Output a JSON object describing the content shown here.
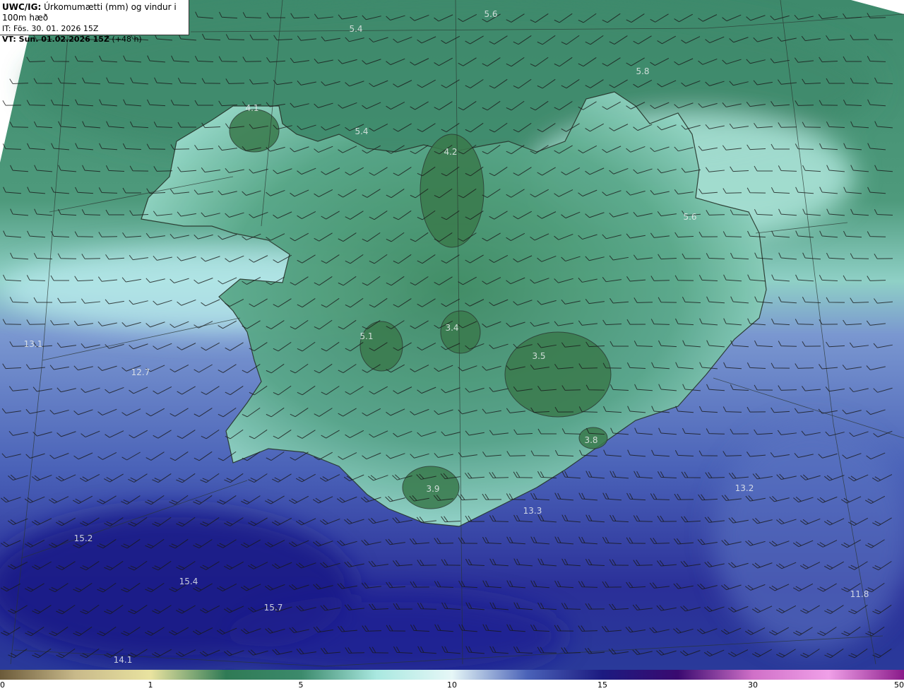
{
  "header": {
    "model_code": "UWC/IG:",
    "title": "Úrkomumætti (mm) og vindur i 100m hæð",
    "init_time": "IT: Fös. 30. 01. 2026 15Z",
    "valid_label": "VT: Sun. 01.02.2026 15Z",
    "lead_time": "(+48 h)"
  },
  "colorbar": {
    "ticks": [
      "0",
      "1",
      "5",
      "10",
      "15",
      "30",
      "50"
    ],
    "colors": [
      "#6b5a3a",
      "#c8b98a",
      "#e9e3a0",
      "#2f7a55",
      "#3c8a6c",
      "#a9e8e0",
      "#e6f7f7",
      "#4a62b8",
      "#1c1a80",
      "#3a0a70",
      "#d070c8",
      "#f0a0e8",
      "#8a1a8a"
    ]
  },
  "map_values": [
    {
      "text": "5.6"
    },
    {
      "text": "5.4"
    },
    {
      "text": "5.8"
    },
    {
      "text": "4.1"
    },
    {
      "text": "5.4"
    },
    {
      "text": "4.2"
    },
    {
      "text": "5.6"
    },
    {
      "text": "3.4"
    },
    {
      "text": "5.1"
    },
    {
      "text": "3.5"
    },
    {
      "text": "13.1"
    },
    {
      "text": "12.7"
    },
    {
      "text": "3.8"
    },
    {
      "text": "3.9"
    },
    {
      "text": "13.2"
    },
    {
      "text": "13.3"
    },
    {
      "text": "15.2"
    },
    {
      "text": "15.4"
    },
    {
      "text": "15.7"
    },
    {
      "text": "11.8"
    },
    {
      "text": "14.1"
    }
  ]
}
